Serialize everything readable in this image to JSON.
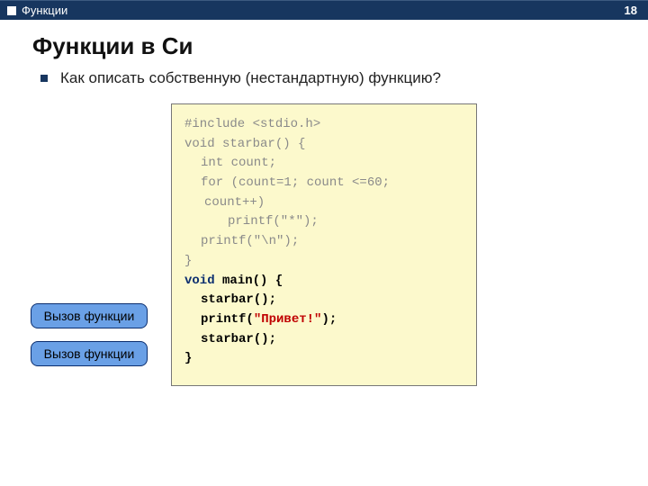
{
  "header": {
    "section": "Функции",
    "page_number": "18"
  },
  "title": "Функции в Си",
  "bullet": "Как описать собственную (нестандартную) функцию?",
  "code": {
    "l1": "#include <stdio.h>",
    "l2": "",
    "l3": "void starbar() {",
    "l4": "int count;",
    "l5": "for (count=1; count <=60;",
    "l5b": "count++)",
    "l6": "printf(\"*\");",
    "l7": "printf(\"\\n\");",
    "l8": "}",
    "m1_kw": "void",
    "m1_rest": " main() {",
    "m2": "starbar();",
    "m3_fn": "printf(",
    "m3_str": "\"Привет!\"",
    "m3_end": ");",
    "m4": "starbar();",
    "m5": "}"
  },
  "callouts": {
    "c1": "Вызов функции",
    "c2": "Вызов функции"
  }
}
